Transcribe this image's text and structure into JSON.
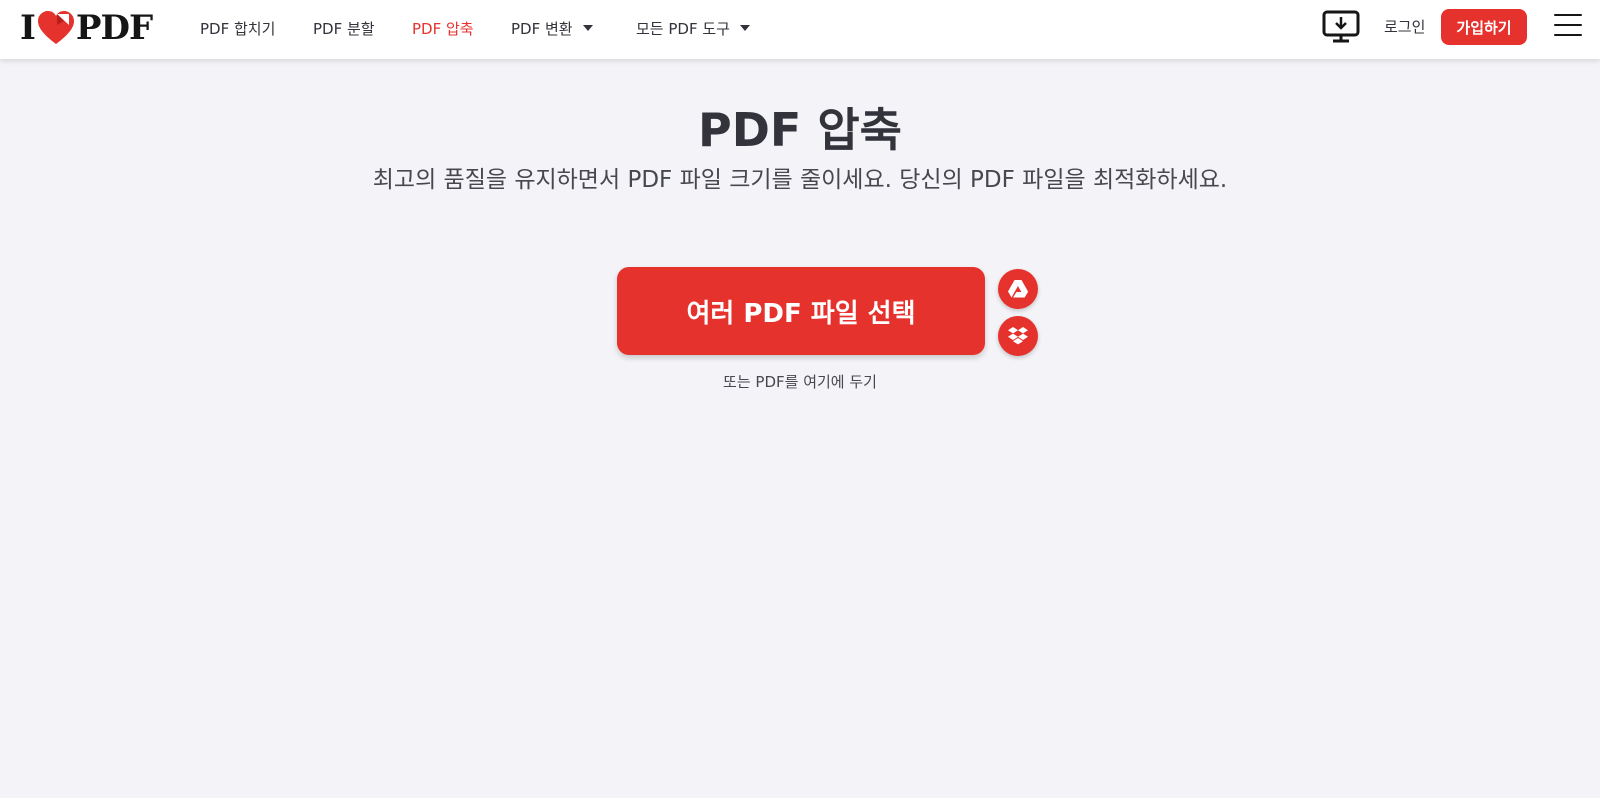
{
  "header": {
    "logo_text_left": "I",
    "logo_text_right": "PDF",
    "nav": [
      {
        "label": "PDF 합치기",
        "active": false,
        "dropdown": false
      },
      {
        "label": "PDF 분할",
        "active": false,
        "dropdown": false
      },
      {
        "label": "PDF 압축",
        "active": true,
        "dropdown": false
      },
      {
        "label": "PDF 변환",
        "active": false,
        "dropdown": true
      },
      {
        "label": "모든 PDF 도구",
        "active": false,
        "dropdown": true
      }
    ],
    "desktop_icon": "desktop-download-icon",
    "login_label": "로그인",
    "signup_label": "가입하기",
    "menu_icon": "hamburger-menu-icon"
  },
  "main": {
    "title": "PDF 압축",
    "subtitle": "최고의 품질을 유지하면서 PDF 파일 크기를 줄이세요. 당신의 PDF 파일을 최적화하세요.",
    "select_button_label": "여러 PDF 파일 선택",
    "cloud_buttons": [
      "google-drive-icon",
      "dropbox-icon"
    ],
    "drop_hint": "또는 PDF를 여기에 두기"
  },
  "colors": {
    "accent": "#e5322d",
    "background": "#f4f4f8",
    "text": "#33333b",
    "header_bg": "#ffffff"
  }
}
